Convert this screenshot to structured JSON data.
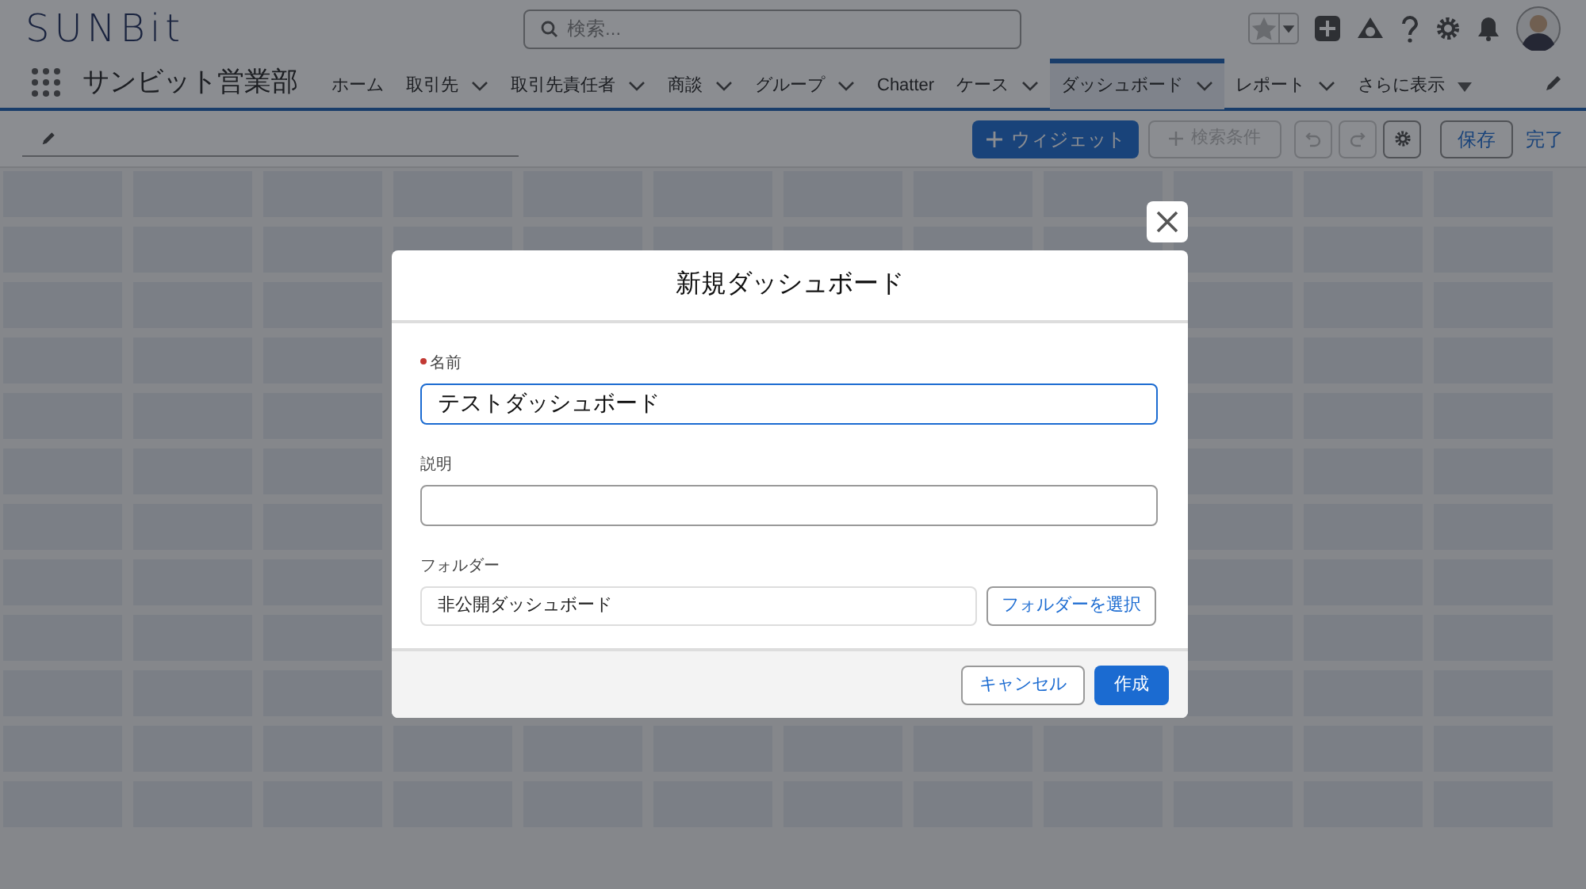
{
  "header": {
    "logo": "SUNBit",
    "search": {
      "placeholder": "検索..."
    }
  },
  "nav": {
    "app_name": "サンビット営業部",
    "tabs": [
      {
        "label": "ホーム",
        "dropdown": false,
        "selected": false,
        "kind": "tab"
      },
      {
        "label": "取引先",
        "dropdown": true,
        "selected": false,
        "kind": "tab"
      },
      {
        "label": "取引先責任者",
        "dropdown": true,
        "selected": false,
        "kind": "tab"
      },
      {
        "label": "商談",
        "dropdown": true,
        "selected": false,
        "kind": "tab"
      },
      {
        "label": "グループ",
        "dropdown": true,
        "selected": false,
        "kind": "tab"
      },
      {
        "label": "Chatter",
        "dropdown": false,
        "selected": false,
        "kind": "tab"
      },
      {
        "label": "ケース",
        "dropdown": true,
        "selected": false,
        "kind": "tab"
      },
      {
        "label": "ダッシュボード",
        "dropdown": true,
        "selected": true,
        "kind": "tab"
      },
      {
        "label": "レポート",
        "dropdown": true,
        "selected": false,
        "kind": "tab"
      },
      {
        "label": "さらに表示",
        "dropdown": true,
        "selected": false,
        "kind": "more"
      }
    ]
  },
  "toolbar": {
    "add_widget": "ウィジェット",
    "add_filter": {
      "label": "検索条件",
      "disabled": true
    },
    "save": "保存",
    "done": "完了"
  },
  "dialog": {
    "title": "新規ダッシュボード",
    "name": {
      "label": "名前",
      "required": true,
      "value": "テストダッシュボード"
    },
    "description": {
      "label": "説明"
    },
    "folder": {
      "label": "フォルダー",
      "value": "非公開ダッシュボード",
      "button": "フォルダーを選択"
    },
    "cancel": "キャンセル",
    "create": "作成"
  }
}
